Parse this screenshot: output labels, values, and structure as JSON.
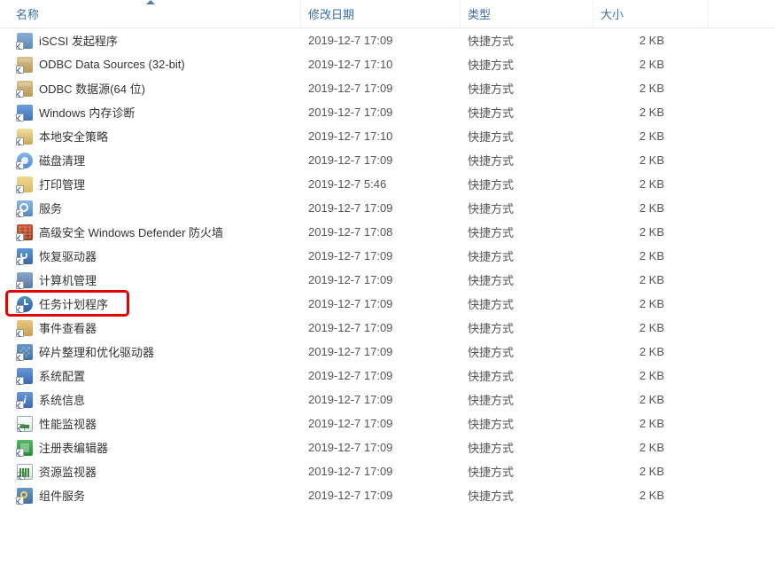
{
  "columns": {
    "name": "名称",
    "date": "修改日期",
    "type": "类型",
    "size": "大小"
  },
  "highlighted_index": 12,
  "items": [
    {
      "icon": "ico-iscsi",
      "name": "iSCSI 发起程序",
      "date": "2019-12-7 17:09",
      "type": "快捷方式",
      "size": "2 KB"
    },
    {
      "icon": "ico-odbc",
      "name": "ODBC Data Sources (32-bit)",
      "date": "2019-12-7 17:10",
      "type": "快捷方式",
      "size": "2 KB"
    },
    {
      "icon": "ico-odbc",
      "name": "ODBC 数据源(64 位)",
      "date": "2019-12-7 17:09",
      "type": "快捷方式",
      "size": "2 KB"
    },
    {
      "icon": "ico-mem",
      "name": "Windows 内存诊断",
      "date": "2019-12-7 17:09",
      "type": "快捷方式",
      "size": "2 KB"
    },
    {
      "icon": "ico-sec",
      "name": "本地安全策略",
      "date": "2019-12-7 17:10",
      "type": "快捷方式",
      "size": "2 KB"
    },
    {
      "icon": "ico-disk",
      "name": "磁盘清理",
      "date": "2019-12-7 17:09",
      "type": "快捷方式",
      "size": "2 KB"
    },
    {
      "icon": "ico-print",
      "name": "打印管理",
      "date": "2019-12-7 5:46",
      "type": "快捷方式",
      "size": "2 KB"
    },
    {
      "icon": "ico-svc",
      "name": "服务",
      "date": "2019-12-7 17:09",
      "type": "快捷方式",
      "size": "2 KB"
    },
    {
      "icon": "ico-fw",
      "name": "高级安全 Windows Defender 防火墙",
      "date": "2019-12-7 17:08",
      "type": "快捷方式",
      "size": "2 KB"
    },
    {
      "icon": "ico-recov",
      "name": "恢复驱动器",
      "date": "2019-12-7 17:09",
      "type": "快捷方式",
      "size": "2 KB"
    },
    {
      "icon": "ico-comp",
      "name": "计算机管理",
      "date": "2019-12-7 17:09",
      "type": "快捷方式",
      "size": "2 KB"
    },
    {
      "icon": "ico-task",
      "name": "任务计划程序",
      "date": "2019-12-7 17:09",
      "type": "快捷方式",
      "size": "2 KB"
    },
    {
      "icon": "ico-event",
      "name": "事件查看器",
      "date": "2019-12-7 17:09",
      "type": "快捷方式",
      "size": "2 KB"
    },
    {
      "icon": "ico-defrag",
      "name": "碎片整理和优化驱动器",
      "date": "2019-12-7 17:09",
      "type": "快捷方式",
      "size": "2 KB"
    },
    {
      "icon": "ico-cfg",
      "name": "系统配置",
      "date": "2019-12-7 17:09",
      "type": "快捷方式",
      "size": "2 KB"
    },
    {
      "icon": "ico-info",
      "name": "系统信息",
      "date": "2019-12-7 17:09",
      "type": "快捷方式",
      "size": "2 KB"
    },
    {
      "icon": "ico-perf",
      "name": "性能监视器",
      "date": "2019-12-7 17:09",
      "type": "快捷方式",
      "size": "2 KB"
    },
    {
      "icon": "ico-reg",
      "name": "注册表编辑器",
      "date": "2019-12-7 17:09",
      "type": "快捷方式",
      "size": "2 KB"
    },
    {
      "icon": "ico-res",
      "name": "资源监视器",
      "date": "2019-12-7 17:09",
      "type": "快捷方式",
      "size": "2 KB"
    },
    {
      "icon": "ico-compsvc",
      "name": "组件服务",
      "date": "2019-12-7 17:09",
      "type": "快捷方式",
      "size": "2 KB"
    }
  ]
}
